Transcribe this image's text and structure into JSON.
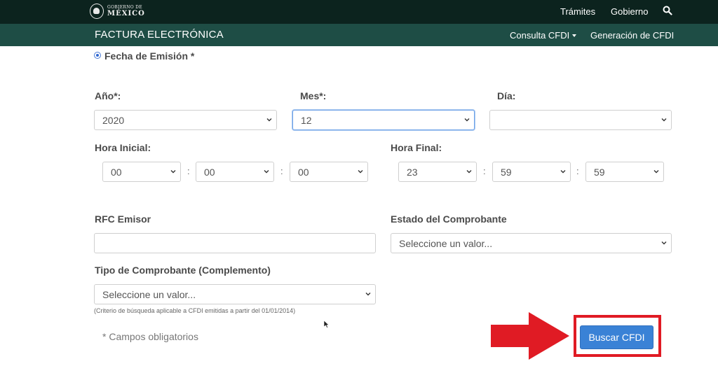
{
  "header": {
    "logo_top": "GOBIERNO DE",
    "logo_bottom": "MÉXICO",
    "links": [
      "Trámites",
      "Gobierno"
    ],
    "search_icon": "search-icon",
    "background": "#0c231e"
  },
  "subheader": {
    "title": "FACTURA ELECTRÓNICA",
    "nav": [
      "Consulta CFDI",
      "Generación de CFDI"
    ],
    "background": "#1e4d45"
  },
  "form": {
    "date_option_label": "Fecha de Emisión *",
    "year": {
      "label": "Año*:",
      "value": "2020"
    },
    "month": {
      "label": "Mes*:",
      "value": "12"
    },
    "day": {
      "label": "Día:",
      "value": ""
    },
    "start_time": {
      "label": "Hora Inicial:",
      "hour": "00",
      "minute": "00",
      "second": "00"
    },
    "end_time": {
      "label": "Hora Final:",
      "hour": "23",
      "minute": "59",
      "second": "59"
    },
    "time_separator": ":",
    "rfc_emisor": {
      "label": "RFC Emisor",
      "value": ""
    },
    "estado": {
      "label": "Estado del Comprobante",
      "value": "Seleccione un valor..."
    },
    "tipo": {
      "label": "Tipo de Comprobante (Complemento)",
      "value": "Seleccione un valor..."
    },
    "hint": "(Criterio de búsqueda aplicable a CFDI emitidas a partir del 01/01/2014)",
    "required_note": "* Campos obligatorios",
    "submit_label": "Buscar CFDI"
  },
  "annotation": {
    "arrow_color": "#e01b24",
    "box_color": "#e01b24"
  },
  "colors": {
    "button": "#3a82d6",
    "focus": "#6fa3e8"
  }
}
